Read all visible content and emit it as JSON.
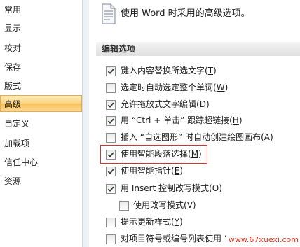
{
  "sidebar": {
    "items": [
      {
        "label": "常用",
        "selected": false
      },
      {
        "label": "显示",
        "selected": false
      },
      {
        "label": "校对",
        "selected": false
      },
      {
        "label": "保存",
        "selected": false
      },
      {
        "label": "版式",
        "selected": false
      },
      {
        "label": "高级",
        "selected": true
      },
      {
        "label": "自定义",
        "selected": false
      },
      {
        "label": "加载项",
        "selected": false
      },
      {
        "label": "信任中心",
        "selected": false
      },
      {
        "label": "资源",
        "selected": false
      }
    ]
  },
  "header": {
    "icon": "document-options-icon",
    "title": "使用 Word 时采用的高级选项。"
  },
  "section": {
    "title": "编辑选项"
  },
  "options": [
    {
      "prefix": "键入内容替换所选文字(",
      "key": "T",
      "suffix": ")",
      "checked": true
    },
    {
      "prefix": "选定时自动选定整个单词(",
      "key": "W",
      "suffix": ")",
      "checked": false
    },
    {
      "prefix": "允许拖放式文字编辑(",
      "key": "D",
      "suffix": ")",
      "checked": true
    },
    {
      "prefix": "用 “Ctrl + 单击” 跟踪超链接(",
      "key": "H",
      "suffix": ")",
      "checked": true
    },
    {
      "prefix": "插入 “自选图形” 时自动创建绘图画布(",
      "key": "A",
      "suffix": ")",
      "checked": false
    },
    {
      "prefix": "使用智能段落选择(",
      "key": "M",
      "suffix": ")",
      "checked": true,
      "highlighted": true
    },
    {
      "prefix": "使用智能指针(",
      "key": "E",
      "suffix": ")",
      "checked": true
    },
    {
      "prefix": "用 Insert 控制改写模式(",
      "key": "O",
      "suffix": ")",
      "checked": true
    },
    {
      "prefix": "使用改写模式(",
      "key": "V",
      "suffix": ")",
      "checked": false,
      "indent": true
    },
    {
      "prefix": "提示更新样式(",
      "key": "Y",
      "suffix": ")",
      "checked": false
    },
    {
      "prefix": "对项目符号或编号列表使用 “",
      "key": "",
      "suffix": "",
      "checked": false
    }
  ],
  "watermark": "www.67xuexi.com",
  "colors": {
    "selected_item": "#f9c35a",
    "highlight_box": "#d2342c",
    "watermark": "#e5341c",
    "section_bg": "#e6e6e6"
  }
}
